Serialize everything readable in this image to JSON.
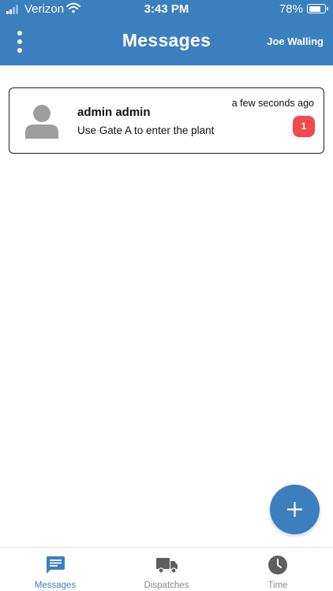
{
  "status_bar": {
    "carrier": "Verizon",
    "time": "3:43 PM",
    "battery": "78%",
    "battery_level": 0.78
  },
  "app_bar": {
    "title": "Messages",
    "user": "Joe Walling",
    "menu_icon": "more-vertical-icon"
  },
  "messages": [
    {
      "sender": "admin admin",
      "preview": "Use Gate A to enter the plant",
      "time": "a few seconds ago",
      "unread": "1",
      "avatar_icon": "person-icon"
    }
  ],
  "fab": {
    "icon": "plus-icon"
  },
  "bottom_nav": {
    "items": [
      {
        "label": "Messages",
        "icon": "chat-icon",
        "active": true
      },
      {
        "label": "Dispatches",
        "icon": "truck-icon",
        "active": false
      },
      {
        "label": "Time",
        "icon": "clock-icon",
        "active": false
      }
    ]
  },
  "colors": {
    "primary": "#3b7fbf",
    "badge": "#f04a4f",
    "inactive_icon": "#5f5f5f",
    "inactive_label": "#888888"
  }
}
